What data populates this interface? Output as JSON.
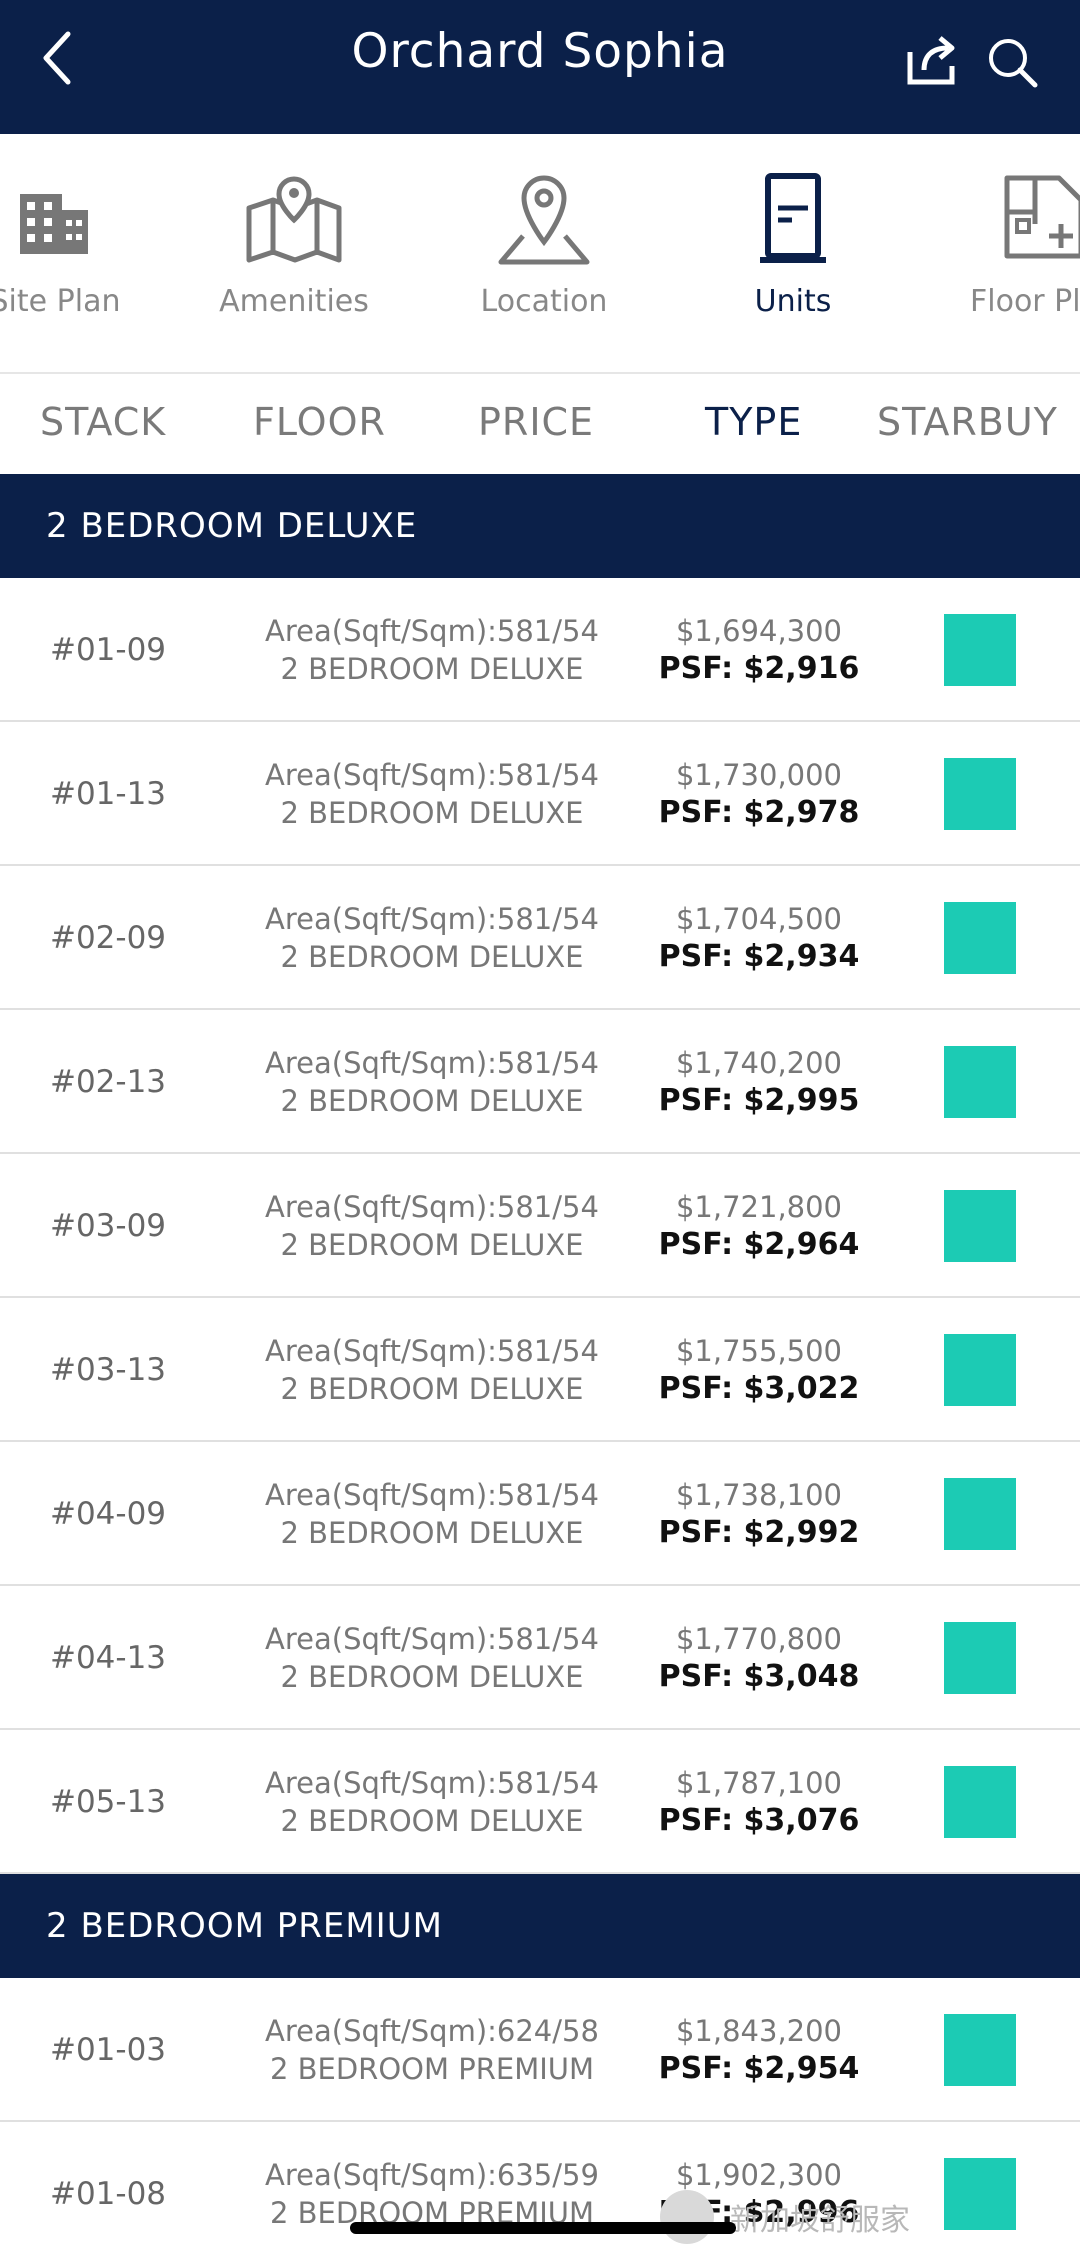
{
  "header": {
    "title": "Orchard Sophia"
  },
  "icon_nav": [
    {
      "label": "Site Plan",
      "icon": "building-icon",
      "active": false
    },
    {
      "label": "Amenities",
      "icon": "map-pin-icon",
      "active": false
    },
    {
      "label": "Location",
      "icon": "location-icon",
      "active": false
    },
    {
      "label": "Units",
      "icon": "door-icon",
      "active": true
    },
    {
      "label": "Floor Plan",
      "icon": "floor-plan-icon",
      "active": false
    }
  ],
  "tabs": [
    {
      "label": "STACK",
      "active": false
    },
    {
      "label": "FLOOR",
      "active": false
    },
    {
      "label": "PRICE",
      "active": false
    },
    {
      "label": "TYPE",
      "active": true
    },
    {
      "label": "STARBUY",
      "active": false
    }
  ],
  "sections": [
    {
      "title": "2 BEDROOM DELUXE",
      "units": [
        {
          "stack": "#01-09",
          "area": "Area(Sqft/Sqm):581/54",
          "type": "2 BEDROOM DELUXE",
          "price": "$1,694,300",
          "psf": "PSF: $2,916"
        },
        {
          "stack": "#01-13",
          "area": "Area(Sqft/Sqm):581/54",
          "type": "2 BEDROOM DELUXE",
          "price": "$1,730,000",
          "psf": "PSF: $2,978"
        },
        {
          "stack": "#02-09",
          "area": "Area(Sqft/Sqm):581/54",
          "type": "2 BEDROOM DELUXE",
          "price": "$1,704,500",
          "psf": "PSF: $2,934"
        },
        {
          "stack": "#02-13",
          "area": "Area(Sqft/Sqm):581/54",
          "type": "2 BEDROOM DELUXE",
          "price": "$1,740,200",
          "psf": "PSF: $2,995"
        },
        {
          "stack": "#03-09",
          "area": "Area(Sqft/Sqm):581/54",
          "type": "2 BEDROOM DELUXE",
          "price": "$1,721,800",
          "psf": "PSF: $2,964"
        },
        {
          "stack": "#03-13",
          "area": "Area(Sqft/Sqm):581/54",
          "type": "2 BEDROOM DELUXE",
          "price": "$1,755,500",
          "psf": "PSF: $3,022"
        },
        {
          "stack": "#04-09",
          "area": "Area(Sqft/Sqm):581/54",
          "type": "2 BEDROOM DELUXE",
          "price": "$1,738,100",
          "psf": "PSF: $2,992"
        },
        {
          "stack": "#04-13",
          "area": "Area(Sqft/Sqm):581/54",
          "type": "2 BEDROOM DELUXE",
          "price": "$1,770,800",
          "psf": "PSF: $3,048"
        },
        {
          "stack": "#05-13",
          "area": "Area(Sqft/Sqm):581/54",
          "type": "2 BEDROOM DELUXE",
          "price": "$1,787,100",
          "psf": "PSF: $3,076"
        }
      ]
    },
    {
      "title": "2 BEDROOM PREMIUM",
      "units": [
        {
          "stack": "#01-03",
          "area": "Area(Sqft/Sqm):624/58",
          "type": "2 BEDROOM PREMIUM",
          "price": "$1,843,200",
          "psf": "PSF: $2,954"
        },
        {
          "stack": "#01-08",
          "area": "Area(Sqft/Sqm):635/59",
          "type": "2 BEDROOM PREMIUM",
          "price": "$1,902,300",
          "psf": "PSF: $2,996"
        }
      ]
    }
  ],
  "colors": {
    "navy": "#0b2049",
    "available": "#1ccbb4"
  },
  "watermark": {
    "text": "新加坡舒服家"
  }
}
